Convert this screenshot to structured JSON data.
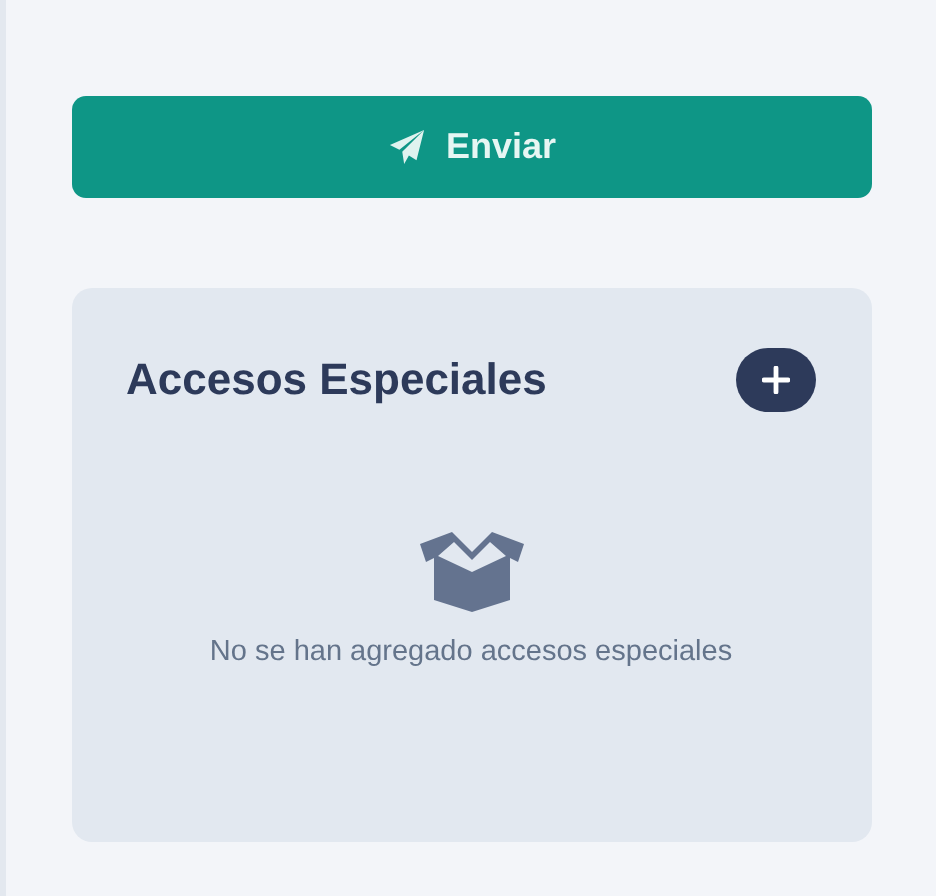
{
  "send_button": {
    "label": "Enviar"
  },
  "special_access": {
    "title": "Accesos Especiales",
    "empty_message": "No se han agregado accesos especiales"
  }
}
